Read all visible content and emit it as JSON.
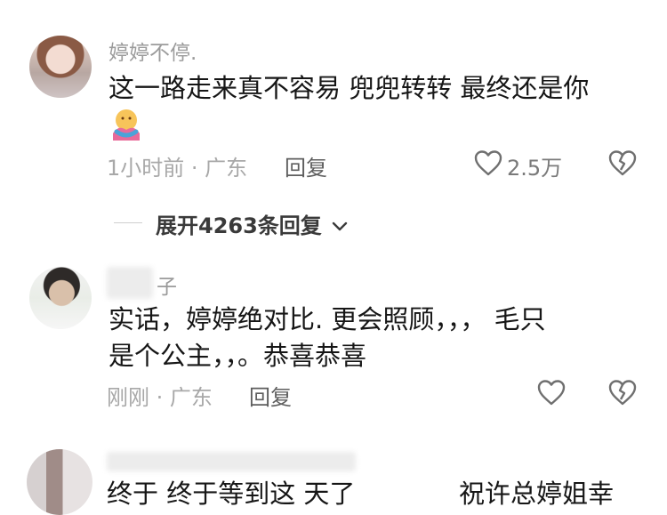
{
  "comments": [
    {
      "username": "婷婷不停.",
      "text": "这一路走来真不容易 兜兜转转 最终还是你",
      "time_location": "1小时前 · 广东",
      "reply_label": "回复",
      "like_count": "2.5万",
      "emoji": "hugging-face-emoji"
    },
    {
      "username": "子",
      "text_line1": "实话，婷婷绝对比.  更会照顾，，，    毛只",
      "text_line2": "是个公主，，。恭喜恭喜",
      "time_location": "刚刚 · 广东",
      "reply_label": "回复"
    },
    {
      "text_partial": "终于 终于等到这   天了",
      "text_partial_tail": "祝许总婷姐幸"
    }
  ],
  "expand_replies": "展开4263条回复",
  "colors": {
    "text_primary": "#161616",
    "text_secondary": "#a8a8a8",
    "username": "#9b9b9b",
    "background": "#ffffff"
  },
  "icons": [
    "heart-outline-icon",
    "broken-heart-icon",
    "chevron-down-icon"
  ]
}
